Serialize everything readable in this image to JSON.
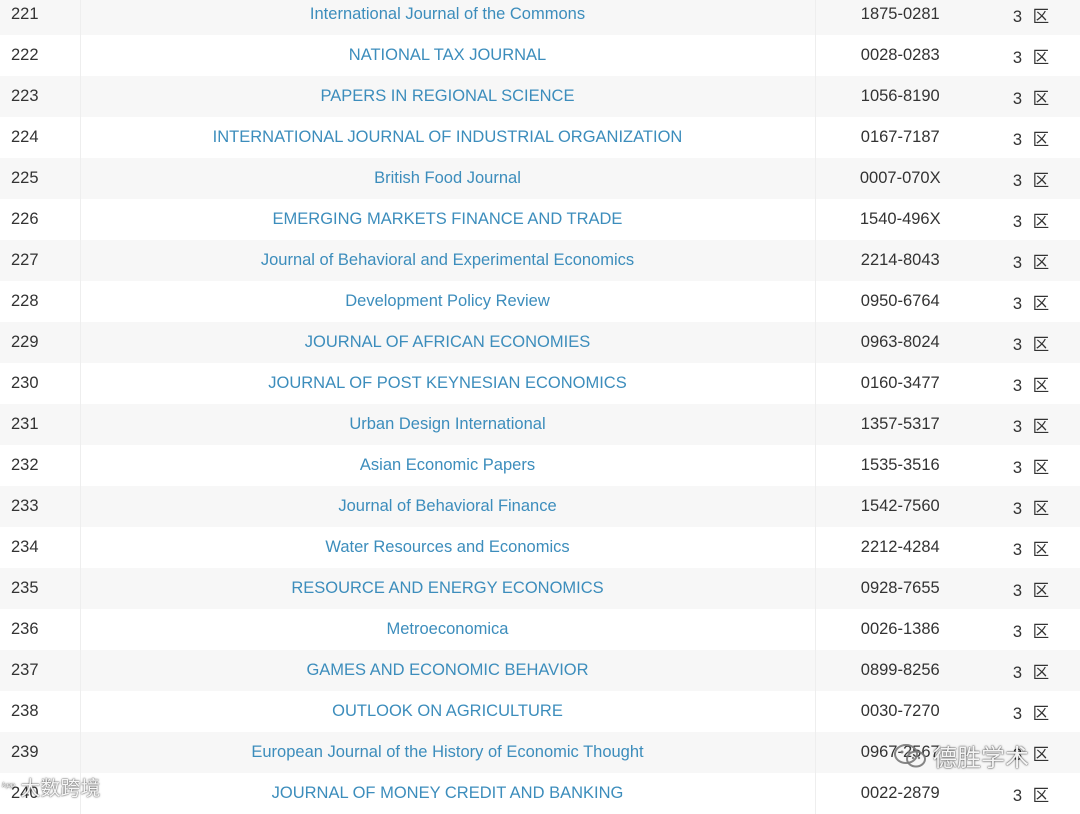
{
  "table": {
    "rows": [
      {
        "rank": "221",
        "title": "International Journal of the Commons",
        "issn": "1875-0281",
        "zone": "3 区"
      },
      {
        "rank": "222",
        "title": "NATIONAL TAX JOURNAL",
        "issn": "0028-0283",
        "zone": "3 区"
      },
      {
        "rank": "223",
        "title": "PAPERS IN REGIONAL SCIENCE",
        "issn": "1056-8190",
        "zone": "3 区"
      },
      {
        "rank": "224",
        "title": "INTERNATIONAL JOURNAL OF INDUSTRIAL ORGANIZATION",
        "issn": "0167-7187",
        "zone": "3 区"
      },
      {
        "rank": "225",
        "title": "British Food Journal",
        "issn": "0007-070X",
        "zone": "3 区"
      },
      {
        "rank": "226",
        "title": "EMERGING MARKETS FINANCE AND TRADE",
        "issn": "1540-496X",
        "zone": "3 区"
      },
      {
        "rank": "227",
        "title": "Journal of Behavioral and Experimental Economics",
        "issn": "2214-8043",
        "zone": "3 区"
      },
      {
        "rank": "228",
        "title": "Development Policy Review",
        "issn": "0950-6764",
        "zone": "3 区"
      },
      {
        "rank": "229",
        "title": "JOURNAL OF AFRICAN ECONOMIES",
        "issn": "0963-8024",
        "zone": "3 区"
      },
      {
        "rank": "230",
        "title": "JOURNAL OF POST KEYNESIAN ECONOMICS",
        "issn": "0160-3477",
        "zone": "3 区"
      },
      {
        "rank": "231",
        "title": "Urban Design International",
        "issn": "1357-5317",
        "zone": "3 区"
      },
      {
        "rank": "232",
        "title": "Asian Economic Papers",
        "issn": "1535-3516",
        "zone": "3 区"
      },
      {
        "rank": "233",
        "title": "Journal of Behavioral Finance",
        "issn": "1542-7560",
        "zone": "3 区"
      },
      {
        "rank": "234",
        "title": "Water Resources and Economics",
        "issn": "2212-4284",
        "zone": "3 区"
      },
      {
        "rank": "235",
        "title": "RESOURCE AND ENERGY ECONOMICS",
        "issn": "0928-7655",
        "zone": "3 区"
      },
      {
        "rank": "236",
        "title": "Metroeconomica",
        "issn": "0026-1386",
        "zone": "3 区"
      },
      {
        "rank": "237",
        "title": "GAMES AND ECONOMIC BEHAVIOR",
        "issn": "0899-8256",
        "zone": "3 区"
      },
      {
        "rank": "238",
        "title": "OUTLOOK ON AGRICULTURE",
        "issn": "0030-7270",
        "zone": "3 区"
      },
      {
        "rank": "239",
        "title": "European Journal of the History of Economic Thought",
        "issn": "0967-2567",
        "zone": "3 区"
      },
      {
        "rank": "240",
        "title": "JOURNAL OF MONEY CREDIT AND BANKING",
        "issn": "0022-2879",
        "zone": "3 区"
      }
    ]
  },
  "watermarks": {
    "left_text": "大数跨境",
    "left_badge": "ᵏᵖᵖ",
    "left_icon": "watermark-logo-icon",
    "right_text": "德胜学术",
    "right_icon": "wechat-icon"
  },
  "colors": {
    "link": "#3c8dbc",
    "text": "#333333",
    "row_stripe": "#f7f7f7"
  }
}
